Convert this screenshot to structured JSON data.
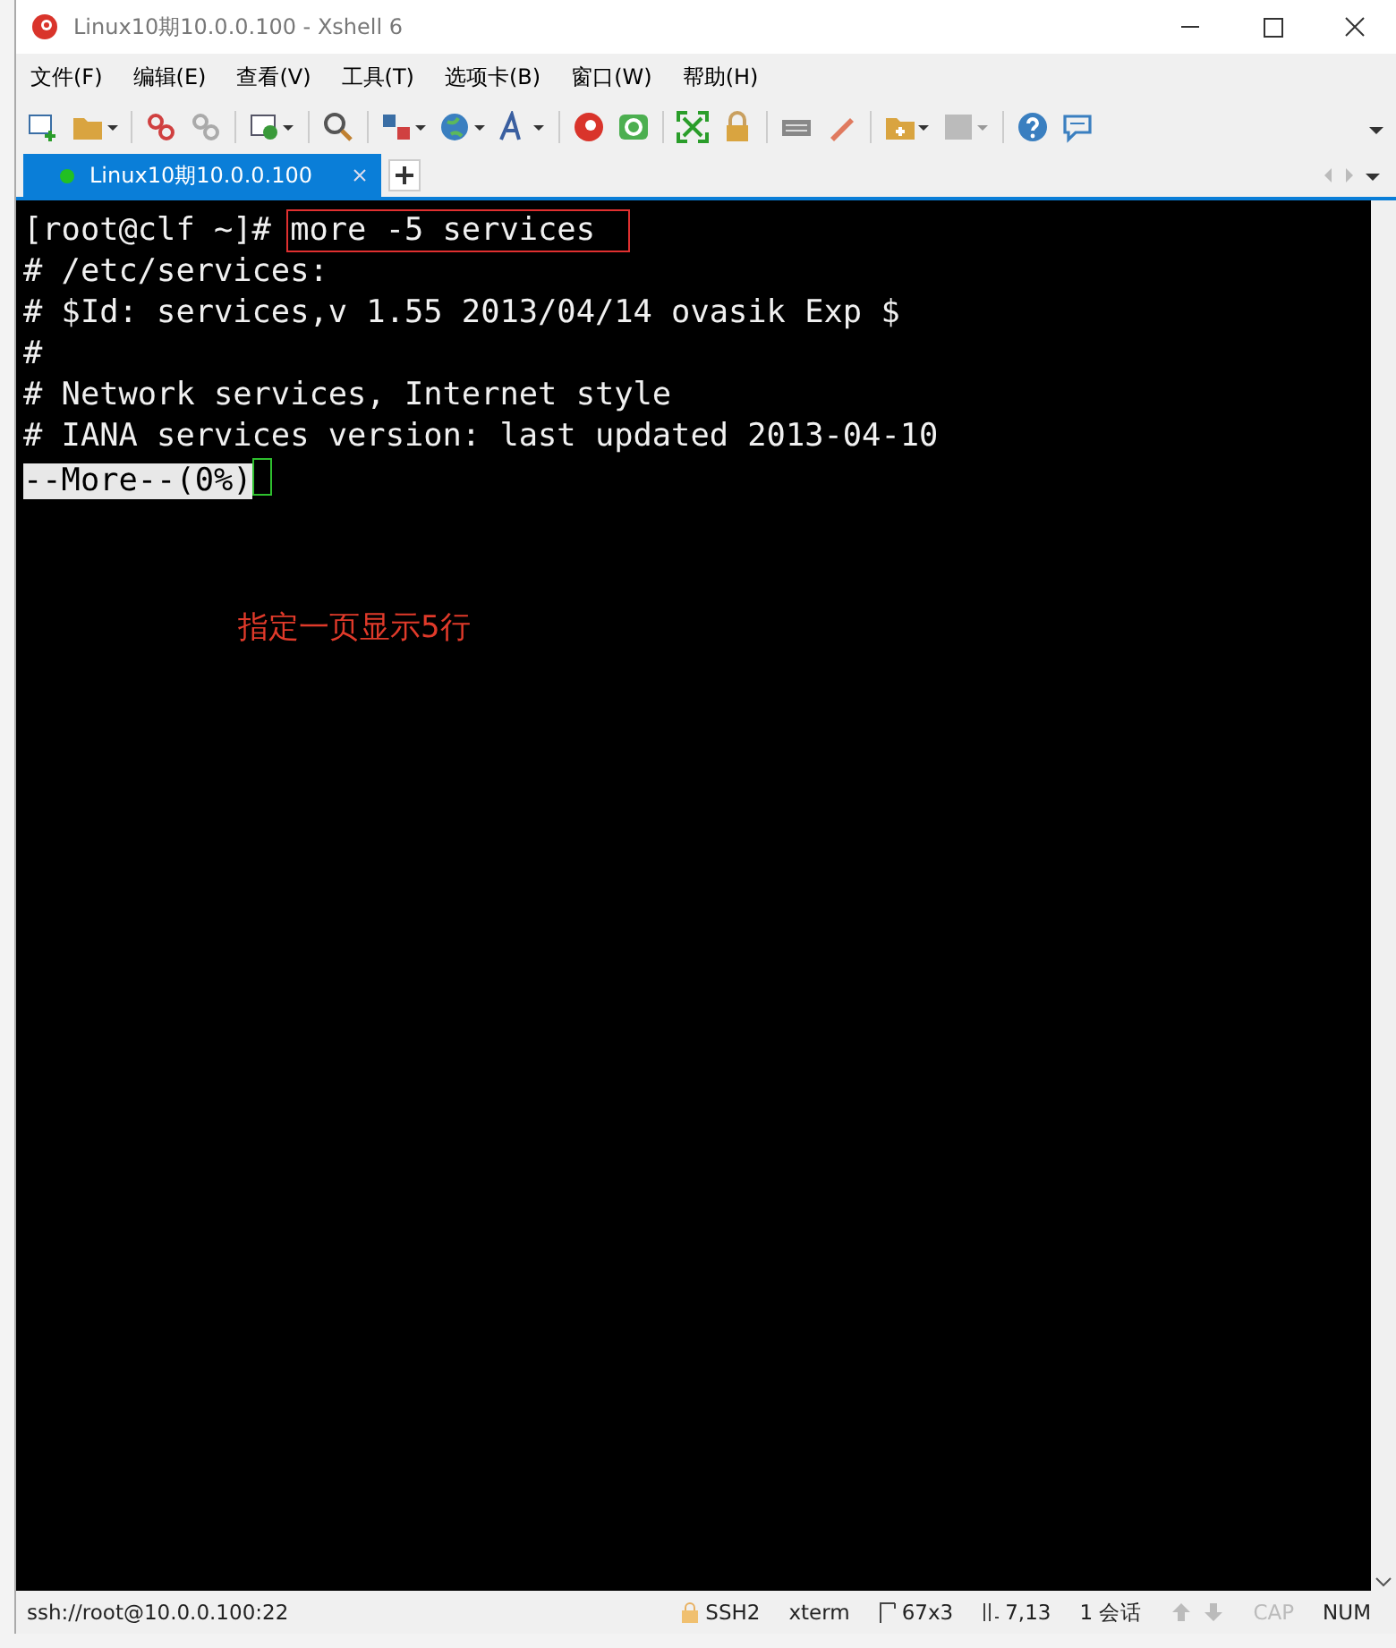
{
  "window": {
    "title": "Linux10期10.0.0.100 - Xshell 6"
  },
  "menu": [
    "文件(F)",
    "编辑(E)",
    "查看(V)",
    "工具(T)",
    "选项卡(B)",
    "窗口(W)",
    "帮助(H)"
  ],
  "tabs": [
    {
      "label": "Linux10期10.0.0.100",
      "selected": true,
      "connected": true
    }
  ],
  "terminal": {
    "lines": [
      {
        "kind": "prompt",
        "prompt": "[root@clf ~]# ",
        "command": "more -5 services",
        "highlighted": true
      },
      {
        "kind": "output",
        "text": "# /etc/services:"
      },
      {
        "kind": "output",
        "text": "# $Id: services,v 1.55 2013/04/14 ovasik Exp $"
      },
      {
        "kind": "output",
        "text": "#"
      },
      {
        "kind": "output",
        "text": "# Network services, Internet style"
      },
      {
        "kind": "output",
        "text": "# IANA services version: last updated 2013-04-10"
      },
      {
        "kind": "pager",
        "text": "--More--(0%)"
      }
    ],
    "annotation": "指定一页显示5行"
  },
  "status_bar": {
    "address": "ssh://root@10.0.0.100:22",
    "items": [
      {
        "kind": "lock",
        "text": "SSH2"
      },
      {
        "kind": "plain",
        "text": "xterm"
      },
      {
        "kind": "size",
        "text": "67x3"
      },
      {
        "kind": "cursor",
        "text": "7,13"
      },
      {
        "kind": "plain",
        "text": "1 会话"
      },
      {
        "kind": "arrows"
      }
    ],
    "keys": [
      {
        "text": "CAP",
        "on": false
      },
      {
        "text": "NUM",
        "on": true
      }
    ]
  }
}
